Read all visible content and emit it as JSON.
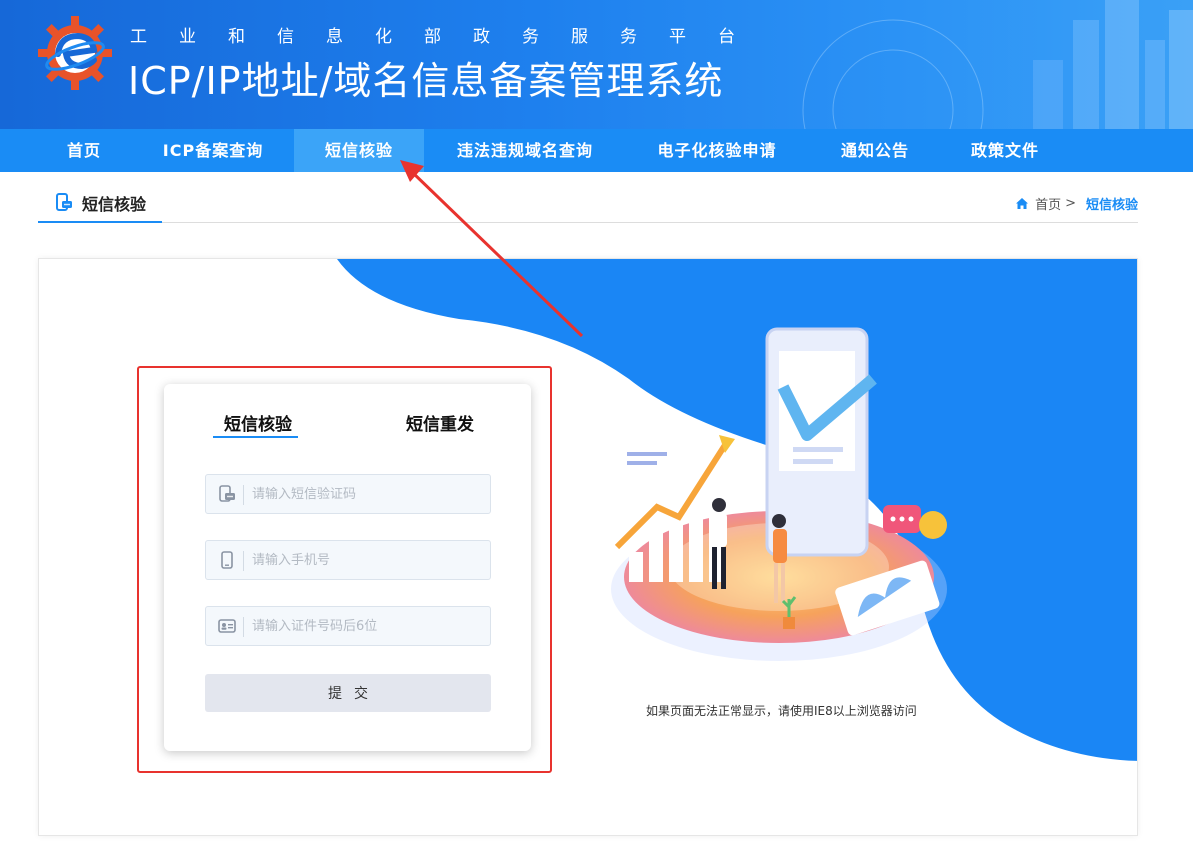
{
  "header": {
    "subtitle": "工业和信息化部政务服务平台",
    "title": "ICP/IP地址/域名信息备案管理系统"
  },
  "nav": {
    "items": [
      {
        "label": "首页"
      },
      {
        "label": "ICP备案查询"
      },
      {
        "label": "短信核验",
        "active": true
      },
      {
        "label": "违法违规域名查询"
      },
      {
        "label": "电子化核验申请"
      },
      {
        "label": "通知公告"
      },
      {
        "label": "政策文件"
      }
    ]
  },
  "section": {
    "title": "短信核验",
    "icon": "phone-message-icon"
  },
  "breadcrumb": {
    "home": "首页",
    "separator": ">",
    "current": "短信核验",
    "icon": "home-icon"
  },
  "form": {
    "tabs": [
      {
        "label": "短信核验",
        "active": true
      },
      {
        "label": "短信重发",
        "active": false
      }
    ],
    "fields": [
      {
        "placeholder": "请输入短信验证码",
        "value": "",
        "icon": "sms-icon"
      },
      {
        "placeholder": "请输入手机号",
        "value": "",
        "icon": "mobile-icon"
      },
      {
        "placeholder": "请输入证件号码后6位",
        "value": "",
        "icon": "id-card-icon"
      }
    ],
    "submit_label": "提交"
  },
  "hint": "如果页面无法正常显示，请使用IE8以上浏览器访问",
  "colors": {
    "nav_bg": "#1a8cf5",
    "nav_active": "#3ba4f8",
    "accent": "#1a8cf5",
    "highlight_red": "#e8332e"
  }
}
